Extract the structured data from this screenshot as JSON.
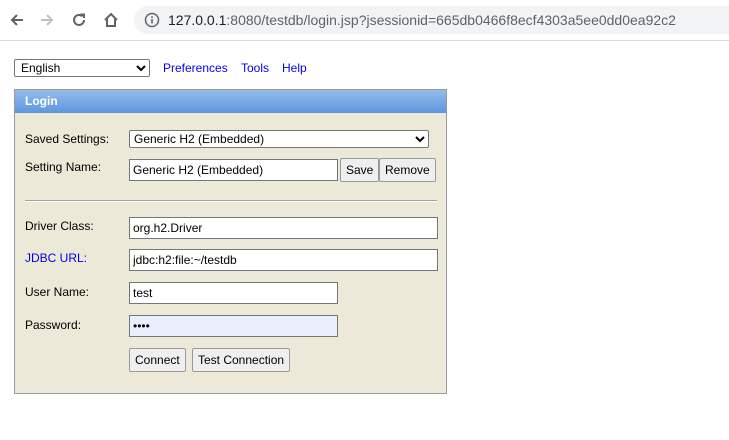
{
  "browser": {
    "url_host": "127.0.0.1",
    "url_rest": ":8080/testdb/login.jsp?jsessionid=665db0466f8ecf4303a5ee0dd0ea92c2"
  },
  "header": {
    "language": "English",
    "links": {
      "preferences": "Preferences",
      "tools": "Tools",
      "help": "Help"
    }
  },
  "login": {
    "title": "Login",
    "saved_settings_label": "Saved Settings:",
    "saved_settings_value": "Generic H2 (Embedded)",
    "setting_name_label": "Setting Name:",
    "setting_name_value": "Generic H2 (Embedded)",
    "save_label": "Save",
    "remove_label": "Remove",
    "driver_class_label": "Driver Class:",
    "driver_class_value": "org.h2.Driver",
    "jdbc_url_label": "JDBC URL:",
    "jdbc_url_value": "jdbc:h2:file:~/testdb",
    "user_name_label": "User Name:",
    "user_name_value": "test",
    "password_label": "Password:",
    "password_value": "••••",
    "connect_label": "Connect",
    "test_connection_label": "Test Connection"
  },
  "colors": {
    "panel_bg": "#ece9d8",
    "header_gradient_top": "#93bcec",
    "header_gradient_bottom": "#5d96dd",
    "link": "#0000ee",
    "autofill_bg": "#e8f0fe"
  },
  "icons": [
    "back-arrow-icon",
    "forward-arrow-icon",
    "reload-icon",
    "home-icon",
    "info-icon"
  ]
}
